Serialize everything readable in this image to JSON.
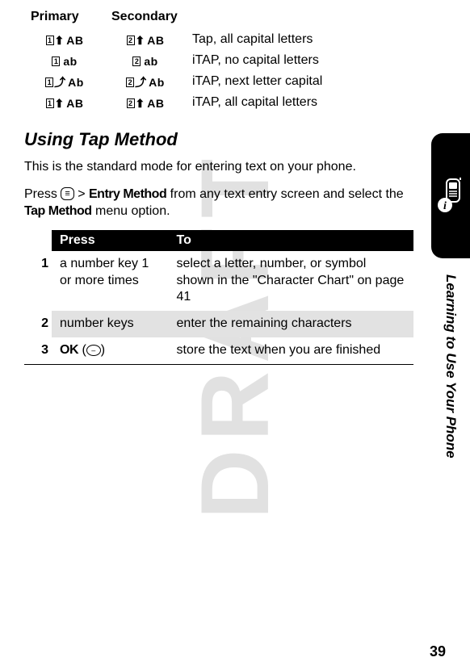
{
  "watermark": "DRAFT",
  "modes": {
    "headers": {
      "primary": "Primary",
      "secondary": "Secondary"
    },
    "rows": [
      {
        "p_box": "1",
        "p_arrow": "⬆",
        "p_suffix": "AB",
        "s_box": "2",
        "s_arrow": "⬆",
        "s_suffix": "AB",
        "desc": "Tap, all capital letters"
      },
      {
        "p_box": "1",
        "p_arrow": "",
        "p_suffix": "ab",
        "s_box": "2",
        "s_arrow": "",
        "s_suffix": "ab",
        "desc": "iTAP, no capital letters"
      },
      {
        "p_box": "1",
        "p_arrow": "⤴",
        "p_suffix": "Ab",
        "s_box": "2",
        "s_arrow": "⤴",
        "s_suffix": "Ab",
        "desc": "iTAP, next letter capital"
      },
      {
        "p_box": "1",
        "p_arrow": "⬆",
        "p_suffix": "AB",
        "s_box": "2",
        "s_arrow": "⬆",
        "s_suffix": "AB",
        "desc": "iTAP, all capital letters"
      }
    ]
  },
  "section_heading": "Using Tap Method",
  "intro_para": "This is the standard mode for entering text on your phone.",
  "press_para_prefix": "Press ",
  "menu_key_glyph": "≡",
  "press_para_mid": " > ",
  "entry_method": "Entry Method",
  "press_para_after": " from any text entry screen and select the ",
  "tap_method": "Tap Method",
  "press_para_end": " menu option.",
  "table": {
    "head_press": "Press",
    "head_to": "To",
    "rows": [
      {
        "n": "1",
        "press": "a number key 1 or more times",
        "to": "select a letter, number, or symbol shown in the \"Character Chart\" on page 41"
      },
      {
        "n": "2",
        "press": "number keys",
        "to": "enter the remaining characters"
      },
      {
        "n": "3",
        "press_bold": "OK",
        "press_key": "–",
        "to": "store the text when you are finished"
      }
    ]
  },
  "side_label": "Learning to Use Your Phone",
  "page_number": "39"
}
